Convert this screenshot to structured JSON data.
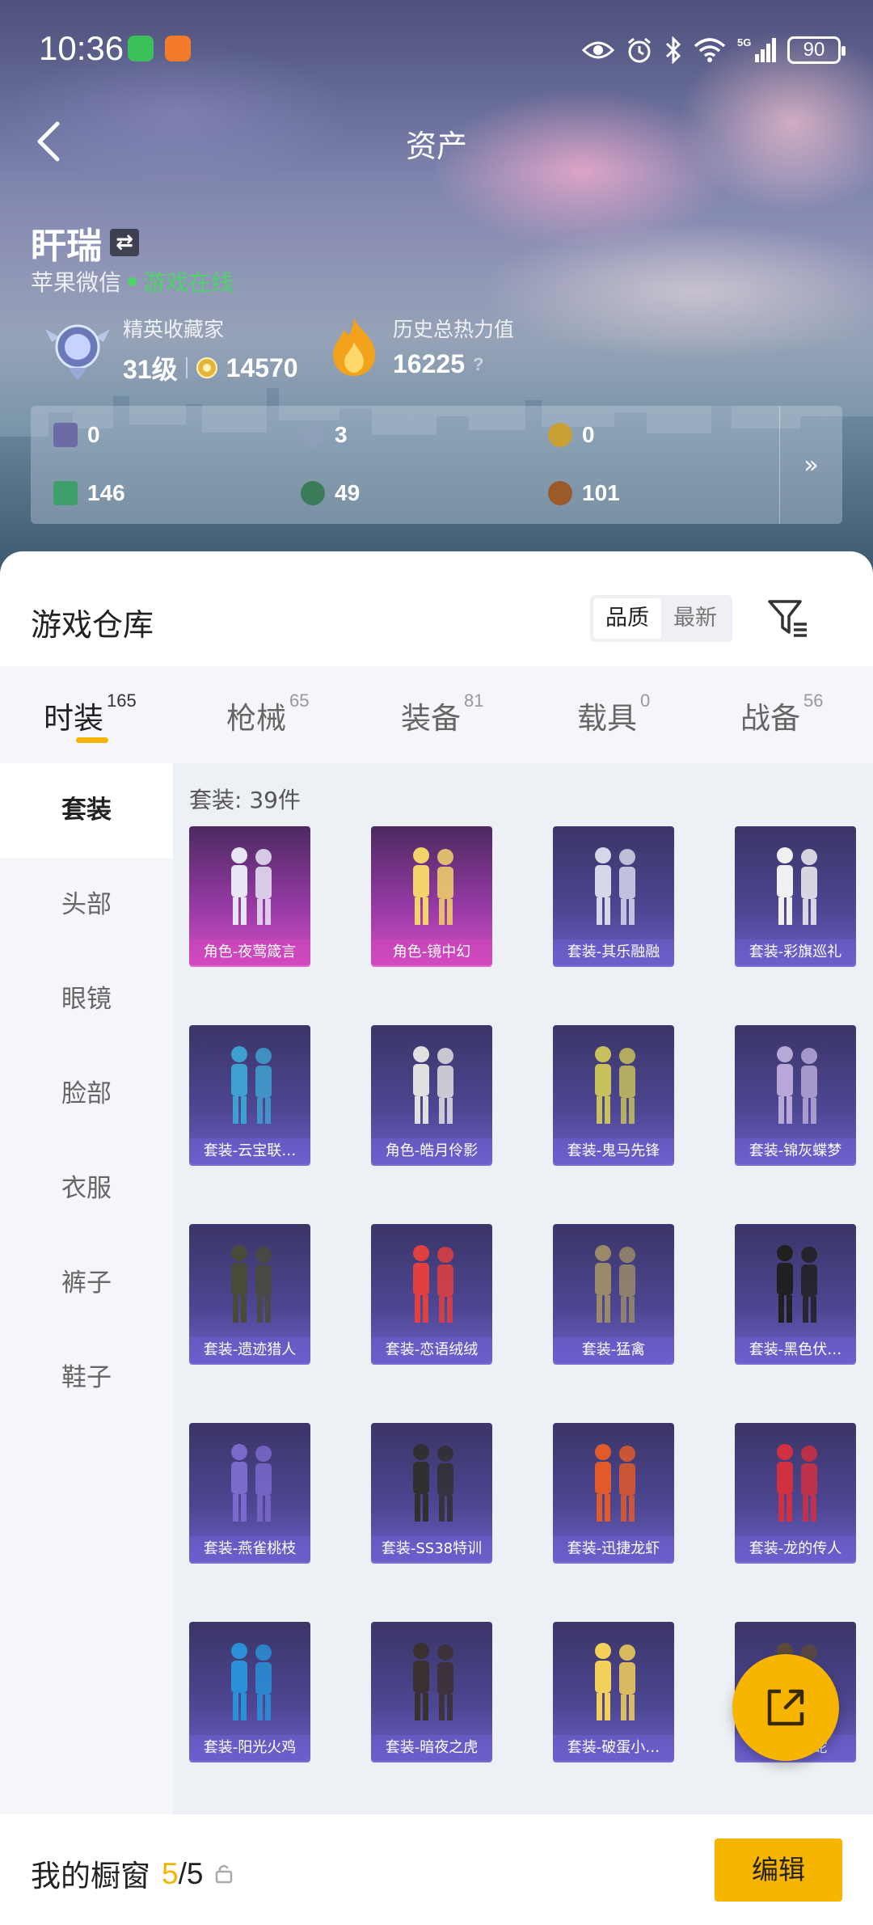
{
  "status_bar": {
    "time": "10:36",
    "battery": "90",
    "icons": [
      "wechat-icon",
      "app-notification-icon",
      "eye-icon",
      "alarm-icon",
      "bluetooth-icon",
      "wifi-icon",
      "signal-5g-icon"
    ]
  },
  "nav": {
    "title": "资产",
    "back_icon": "chevron-left-icon"
  },
  "profile": {
    "name": "盰瑞",
    "platform": "苹果微信",
    "online_status": "游戏在线",
    "collector": {
      "label": "精英收藏家",
      "level": "31级",
      "points": "14570"
    },
    "heat": {
      "label": "历史总热力值",
      "value": "16225",
      "help": "?"
    }
  },
  "currencies": [
    {
      "icon": "card-icon",
      "value": "0",
      "color": "#6d6aa8"
    },
    {
      "icon": "coin-silver-icon",
      "value": "3",
      "color": "#8ea0b8"
    },
    {
      "icon": "coin-gold-icon",
      "value": "0",
      "color": "#c9a033"
    },
    {
      "icon": "ticket-green-icon",
      "value": "146",
      "color": "#3f9f6a"
    },
    {
      "icon": "orb-green-icon",
      "value": "49",
      "color": "#3a7c5a"
    },
    {
      "icon": "coin-bronze-icon",
      "value": "101",
      "color": "#9a5a2a"
    }
  ],
  "currency_more": "»",
  "warehouse": {
    "title": "游戏仓库",
    "sort_options": [
      "品质",
      "最新"
    ],
    "filter_icon": "filter-icon"
  },
  "tabs": [
    {
      "label": "时装",
      "count": "165"
    },
    {
      "label": "枪械",
      "count": "65"
    },
    {
      "label": "装备",
      "count": "81"
    },
    {
      "label": "载具",
      "count": "0"
    },
    {
      "label": "战备",
      "count": "56"
    }
  ],
  "sidebar": [
    "套装",
    "头部",
    "眼镜",
    "脸部",
    "衣服",
    "裤子",
    "鞋子"
  ],
  "content": {
    "count_label": "套装: 39件",
    "items": [
      {
        "label": "角色-夜莺箴言",
        "rarity": "pink"
      },
      {
        "label": "角色-镜中幻",
        "rarity": "pink"
      },
      {
        "label": "套装-其乐融融",
        "rarity": "purple"
      },
      {
        "label": "套装-彩旗巡礼",
        "rarity": "purple"
      },
      {
        "label": "套装-云宝联…",
        "rarity": "purple"
      },
      {
        "label": "角色-皓月伶影",
        "rarity": "purple"
      },
      {
        "label": "套装-鬼马先锋",
        "rarity": "purple"
      },
      {
        "label": "套装-锦灰蝶梦",
        "rarity": "purple"
      },
      {
        "label": "套装-遗迹猎人",
        "rarity": "purple"
      },
      {
        "label": "套装-恋语绒绒",
        "rarity": "purple"
      },
      {
        "label": "套装-猛禽",
        "rarity": "purple"
      },
      {
        "label": "套装-黑色伏…",
        "rarity": "purple"
      },
      {
        "label": "套装-燕雀桃枝",
        "rarity": "purple"
      },
      {
        "label": "套装-SS38特训",
        "rarity": "purple"
      },
      {
        "label": "套装-迅捷龙虾",
        "rarity": "purple"
      },
      {
        "label": "套装-龙的传人",
        "rarity": "purple"
      },
      {
        "label": "套装-阳光火鸡",
        "rarity": "purple"
      },
      {
        "label": "套装-暗夜之虎",
        "rarity": "purple"
      },
      {
        "label": "套装-破蛋小…",
        "rarity": "purple"
      },
      {
        "label": "套装-…蛇",
        "rarity": "purple"
      }
    ]
  },
  "fab_icon": "share-icon",
  "bottom": {
    "window_label": "我的橱窗",
    "window_count": "5",
    "window_total": "/5",
    "lock_icon": "lock-icon",
    "edit_label": "编辑"
  }
}
